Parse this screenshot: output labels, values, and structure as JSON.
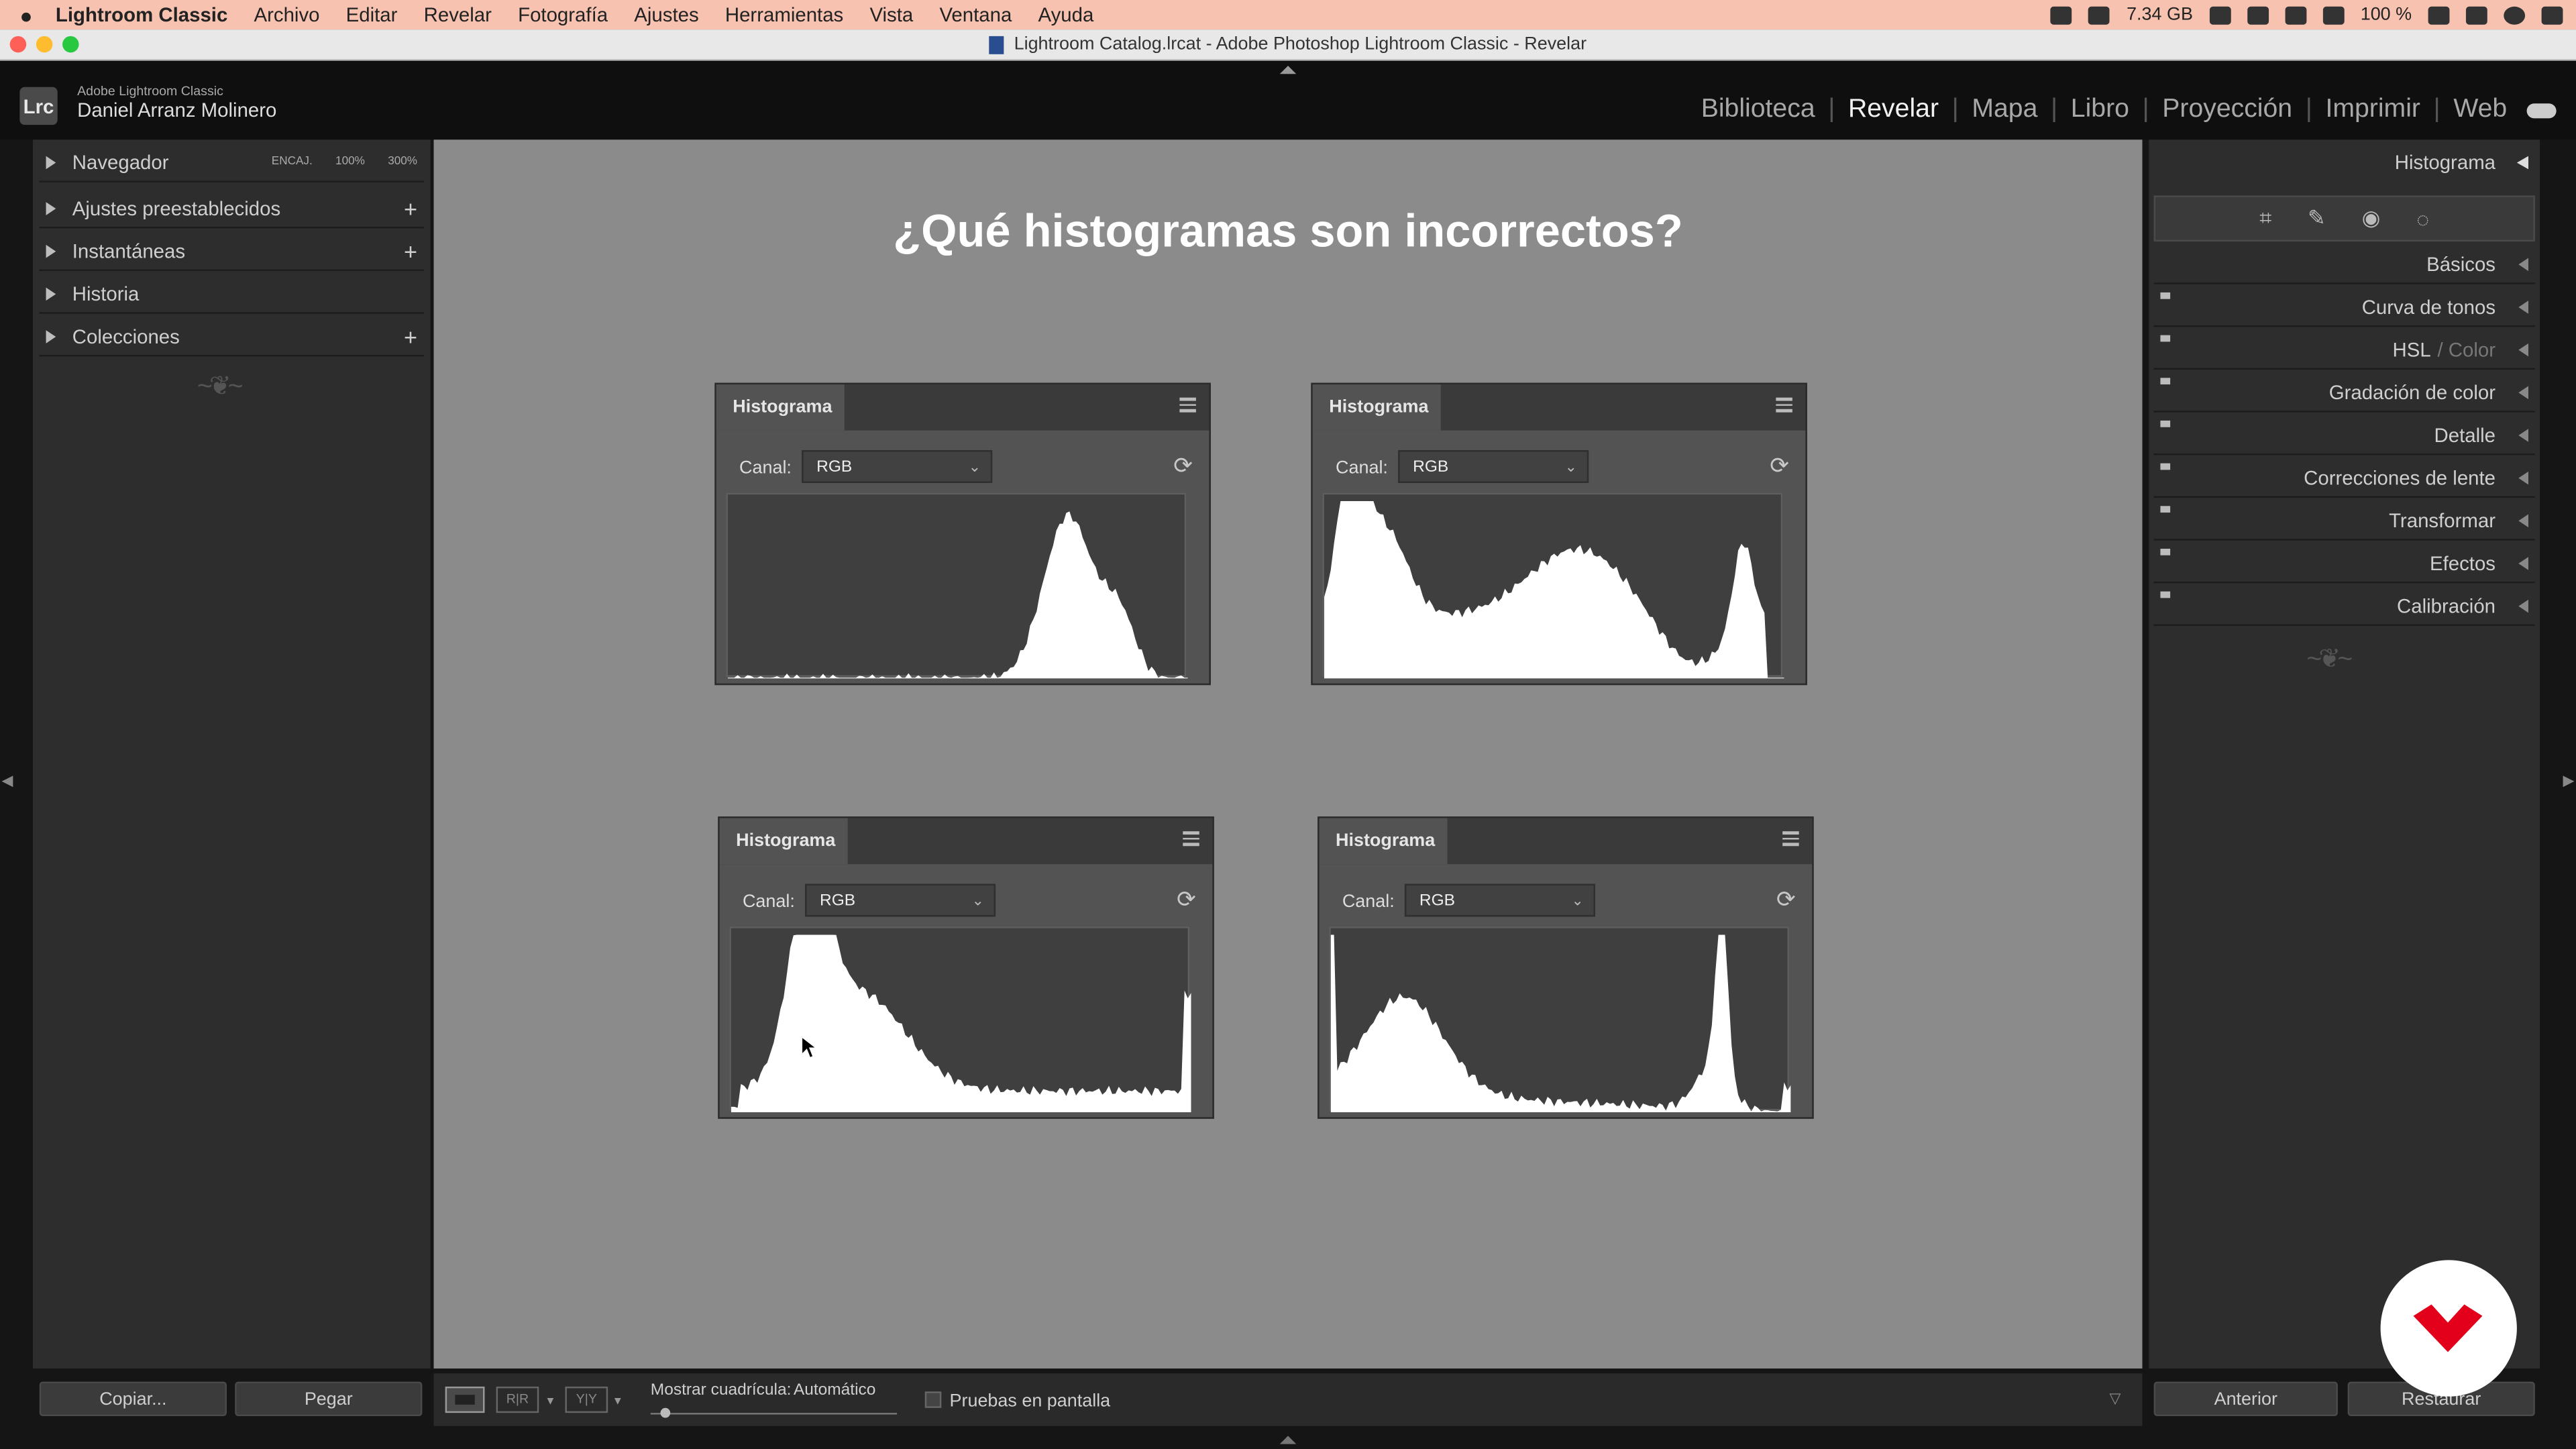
{
  "menubar": {
    "app": "Lightroom Classic",
    "items": [
      "Archivo",
      "Editar",
      "Revelar",
      "Fotografía",
      "Ajustes",
      "Herramientas",
      "Vista",
      "Ventana",
      "Ayuda"
    ],
    "memory": "7.34 GB",
    "battery": "100 %"
  },
  "window": {
    "title": "Lightroom Catalog.lrcat - Adobe Photoshop Lightroom Classic - Revelar"
  },
  "header": {
    "logo": "Lrc",
    "product": "Adobe Lightroom Classic",
    "user": "Daniel Arranz Molinero",
    "modules": [
      "Biblioteca",
      "Revelar",
      "Mapa",
      "Libro",
      "Proyección",
      "Imprimir",
      "Web"
    ],
    "active_module": "Revelar"
  },
  "left": {
    "navigator": {
      "label": "Navegador",
      "zoom_fit": "ENCAJ.",
      "zoom_100": "100%",
      "zoom_300": "300%"
    },
    "panels": [
      "Ajustes preestablecidos",
      "Instantáneas",
      "Historia",
      "Colecciones"
    ],
    "copy": "Copiar...",
    "paste": "Pegar"
  },
  "center": {
    "question": "¿Qué histogramas son incorrectos?",
    "histograms": [
      {
        "title": "Histograma",
        "canal_label": "Canal:",
        "channel": "RGB",
        "shape": "highkey"
      },
      {
        "title": "Histograma",
        "canal_label": "Canal:",
        "channel": "RGB",
        "shape": "full"
      },
      {
        "title": "Histograma",
        "canal_label": "Canal:",
        "channel": "RGB",
        "shape": "lowkey"
      },
      {
        "title": "Histograma",
        "canal_label": "Canal:",
        "channel": "RGB",
        "shape": "bimodal"
      }
    ]
  },
  "right": {
    "histogram_label": "Histograma",
    "panels": [
      "Básicos",
      "Curva de tonos",
      "HSL",
      "Gradación de color",
      "Detalle",
      "Correcciones de lente",
      "Transformar",
      "Efectos",
      "Calibración"
    ],
    "hsl_suffix": "/ Color",
    "prev": "Anterior",
    "reset": "Restaurar"
  },
  "toolbar": {
    "grid_label": "Mostrar cuadrícula:",
    "grid_value": "Automático",
    "softproof": "Pruebas en pantalla"
  },
  "colors": {
    "menubar": "#f7c2b0",
    "panel": "#2d2d2d",
    "canvas": "#8b8b8b",
    "brand": "#e3001b"
  }
}
